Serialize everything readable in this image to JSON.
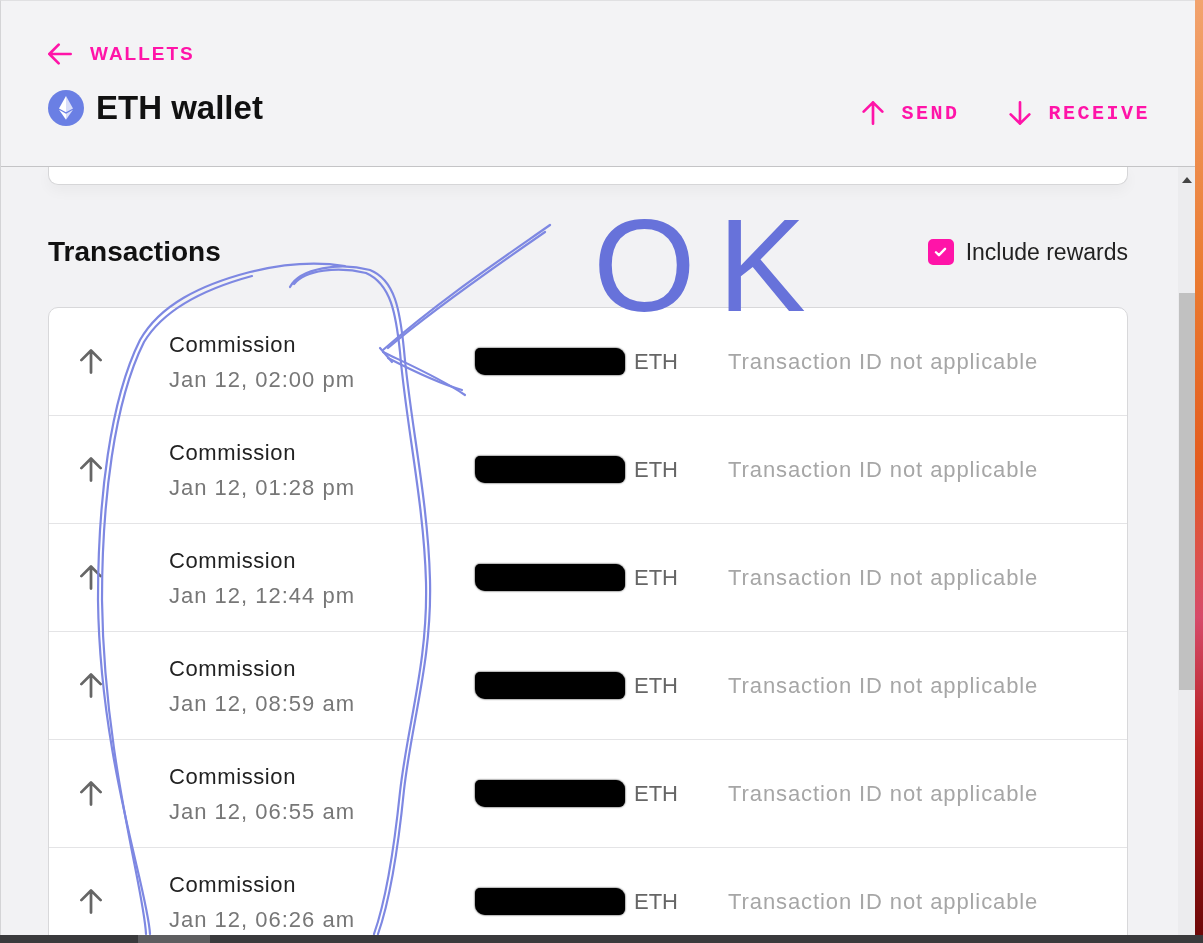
{
  "header": {
    "back_link": "WALLETS",
    "title": "ETH wallet",
    "actions": [
      {
        "kind": "send",
        "label": "SEND"
      },
      {
        "kind": "receive",
        "label": "RECEIVE"
      }
    ]
  },
  "transactions": {
    "title": "Transactions",
    "include_rewards": {
      "label": "Include rewards",
      "checked": true
    },
    "rows": [
      {
        "kind": "outgoing",
        "type": "Commission",
        "date": "Jan 12, 02:00 pm",
        "amount_redacted": true,
        "currency": "ETH",
        "transaction_id": "Transaction ID not applicable"
      },
      {
        "kind": "outgoing",
        "type": "Commission",
        "date": "Jan 12, 01:28 pm",
        "amount_redacted": true,
        "currency": "ETH",
        "transaction_id": "Transaction ID not applicable"
      },
      {
        "kind": "outgoing",
        "type": "Commission",
        "date": "Jan 12, 12:44 pm",
        "amount_redacted": true,
        "currency": "ETH",
        "transaction_id": "Transaction ID not applicable"
      },
      {
        "kind": "outgoing",
        "type": "Commission",
        "date": "Jan 12, 08:59 am",
        "amount_redacted": true,
        "currency": "ETH",
        "transaction_id": "Transaction ID not applicable"
      },
      {
        "kind": "outgoing",
        "type": "Commission",
        "date": "Jan 12, 06:55 am",
        "amount_redacted": true,
        "currency": "ETH",
        "transaction_id": "Transaction ID not applicable"
      },
      {
        "kind": "outgoing",
        "type": "Commission",
        "date": "Jan 12, 06:26 am",
        "amount_redacted": true,
        "currency": "ETH",
        "transaction_id": "Transaction ID not applicable"
      }
    ]
  },
  "annotation": {
    "text": "OK"
  }
}
